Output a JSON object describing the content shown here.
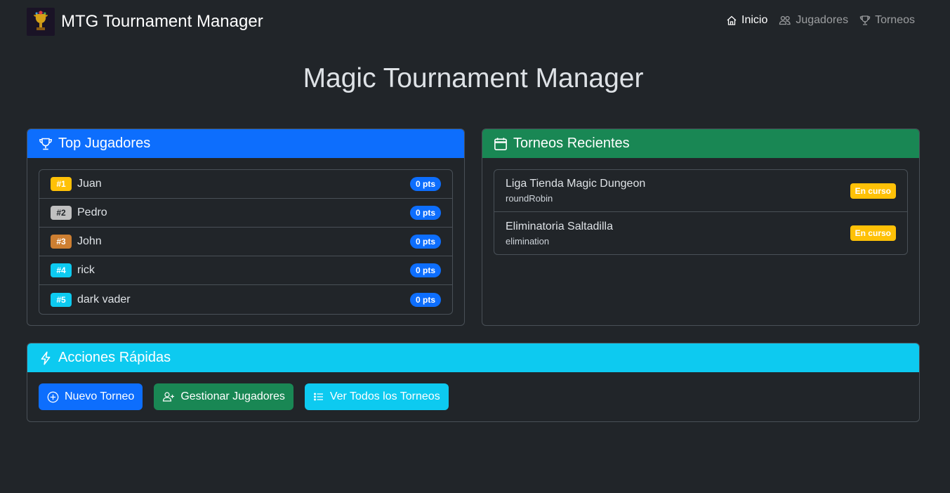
{
  "brand": {
    "title": "MTG Tournament Manager"
  },
  "nav": {
    "items": [
      {
        "label": "Inicio",
        "icon": "house-icon",
        "active": true
      },
      {
        "label": "Jugadores",
        "icon": "people-icon",
        "active": false
      },
      {
        "label": "Torneos",
        "icon": "trophy-icon",
        "active": false
      }
    ]
  },
  "page": {
    "title": "Magic Tournament Manager"
  },
  "top_players": {
    "title": "Top Jugadores",
    "players": [
      {
        "rank": "#1",
        "name": "Juan",
        "points": "0 pts",
        "rank_color": "#ffc107"
      },
      {
        "rank": "#2",
        "name": "Pedro",
        "points": "0 pts",
        "rank_color": "#c0c0c0"
      },
      {
        "rank": "#3",
        "name": "John",
        "points": "0 pts",
        "rank_color": "#cd7f32"
      },
      {
        "rank": "#4",
        "name": "rick",
        "points": "0 pts",
        "rank_color": "#0dcaf0"
      },
      {
        "rank": "#5",
        "name": "dark vader",
        "points": "0 pts",
        "rank_color": "#0dcaf0"
      }
    ]
  },
  "recent_tournaments": {
    "title": "Torneos Recientes",
    "items": [
      {
        "name": "Liga Tienda Magic Dungeon",
        "type": "roundRobin",
        "status": "En curso"
      },
      {
        "name": "Eliminatoria Saltadilla",
        "type": "elimination",
        "status": "En curso"
      }
    ]
  },
  "quick_actions": {
    "title": "Acciones Rápidas",
    "buttons": [
      {
        "label": "Nuevo Torneo",
        "icon": "plus-circle-icon"
      },
      {
        "label": "Gestionar Jugadores",
        "icon": "person-add-icon"
      },
      {
        "label": "Ver Todos los Torneos",
        "icon": "list-icon"
      }
    ]
  },
  "colors": {
    "background": "#212529",
    "primary": "#0d6efd",
    "success": "#198754",
    "info": "#0dcaf0",
    "warning": "#ffc107"
  }
}
